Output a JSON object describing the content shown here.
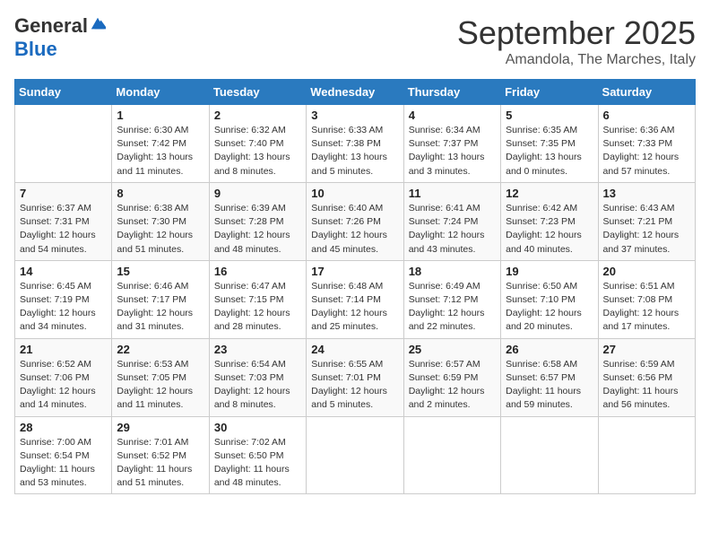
{
  "logo": {
    "general": "General",
    "blue": "Blue"
  },
  "title": "September 2025",
  "location": "Amandola, The Marches, Italy",
  "days_of_week": [
    "Sunday",
    "Monday",
    "Tuesday",
    "Wednesday",
    "Thursday",
    "Friday",
    "Saturday"
  ],
  "weeks": [
    [
      {
        "day": null
      },
      {
        "day": "1",
        "sunrise": "6:30 AM",
        "sunset": "7:42 PM",
        "daylight": "13 hours and 11 minutes."
      },
      {
        "day": "2",
        "sunrise": "6:32 AM",
        "sunset": "7:40 PM",
        "daylight": "13 hours and 8 minutes."
      },
      {
        "day": "3",
        "sunrise": "6:33 AM",
        "sunset": "7:38 PM",
        "daylight": "13 hours and 5 minutes."
      },
      {
        "day": "4",
        "sunrise": "6:34 AM",
        "sunset": "7:37 PM",
        "daylight": "13 hours and 3 minutes."
      },
      {
        "day": "5",
        "sunrise": "6:35 AM",
        "sunset": "7:35 PM",
        "daylight": "13 hours and 0 minutes."
      },
      {
        "day": "6",
        "sunrise": "6:36 AM",
        "sunset": "7:33 PM",
        "daylight": "12 hours and 57 minutes."
      }
    ],
    [
      {
        "day": "7",
        "sunrise": "6:37 AM",
        "sunset": "7:31 PM",
        "daylight": "12 hours and 54 minutes."
      },
      {
        "day": "8",
        "sunrise": "6:38 AM",
        "sunset": "7:30 PM",
        "daylight": "12 hours and 51 minutes."
      },
      {
        "day": "9",
        "sunrise": "6:39 AM",
        "sunset": "7:28 PM",
        "daylight": "12 hours and 48 minutes."
      },
      {
        "day": "10",
        "sunrise": "6:40 AM",
        "sunset": "7:26 PM",
        "daylight": "12 hours and 45 minutes."
      },
      {
        "day": "11",
        "sunrise": "6:41 AM",
        "sunset": "7:24 PM",
        "daylight": "12 hours and 43 minutes."
      },
      {
        "day": "12",
        "sunrise": "6:42 AM",
        "sunset": "7:23 PM",
        "daylight": "12 hours and 40 minutes."
      },
      {
        "day": "13",
        "sunrise": "6:43 AM",
        "sunset": "7:21 PM",
        "daylight": "12 hours and 37 minutes."
      }
    ],
    [
      {
        "day": "14",
        "sunrise": "6:45 AM",
        "sunset": "7:19 PM",
        "daylight": "12 hours and 34 minutes."
      },
      {
        "day": "15",
        "sunrise": "6:46 AM",
        "sunset": "7:17 PM",
        "daylight": "12 hours and 31 minutes."
      },
      {
        "day": "16",
        "sunrise": "6:47 AM",
        "sunset": "7:15 PM",
        "daylight": "12 hours and 28 minutes."
      },
      {
        "day": "17",
        "sunrise": "6:48 AM",
        "sunset": "7:14 PM",
        "daylight": "12 hours and 25 minutes."
      },
      {
        "day": "18",
        "sunrise": "6:49 AM",
        "sunset": "7:12 PM",
        "daylight": "12 hours and 22 minutes."
      },
      {
        "day": "19",
        "sunrise": "6:50 AM",
        "sunset": "7:10 PM",
        "daylight": "12 hours and 20 minutes."
      },
      {
        "day": "20",
        "sunrise": "6:51 AM",
        "sunset": "7:08 PM",
        "daylight": "12 hours and 17 minutes."
      }
    ],
    [
      {
        "day": "21",
        "sunrise": "6:52 AM",
        "sunset": "7:06 PM",
        "daylight": "12 hours and 14 minutes."
      },
      {
        "day": "22",
        "sunrise": "6:53 AM",
        "sunset": "7:05 PM",
        "daylight": "12 hours and 11 minutes."
      },
      {
        "day": "23",
        "sunrise": "6:54 AM",
        "sunset": "7:03 PM",
        "daylight": "12 hours and 8 minutes."
      },
      {
        "day": "24",
        "sunrise": "6:55 AM",
        "sunset": "7:01 PM",
        "daylight": "12 hours and 5 minutes."
      },
      {
        "day": "25",
        "sunrise": "6:57 AM",
        "sunset": "6:59 PM",
        "daylight": "12 hours and 2 minutes."
      },
      {
        "day": "26",
        "sunrise": "6:58 AM",
        "sunset": "6:57 PM",
        "daylight": "11 hours and 59 minutes."
      },
      {
        "day": "27",
        "sunrise": "6:59 AM",
        "sunset": "6:56 PM",
        "daylight": "11 hours and 56 minutes."
      }
    ],
    [
      {
        "day": "28",
        "sunrise": "7:00 AM",
        "sunset": "6:54 PM",
        "daylight": "11 hours and 53 minutes."
      },
      {
        "day": "29",
        "sunrise": "7:01 AM",
        "sunset": "6:52 PM",
        "daylight": "11 hours and 51 minutes."
      },
      {
        "day": "30",
        "sunrise": "7:02 AM",
        "sunset": "6:50 PM",
        "daylight": "11 hours and 48 minutes."
      },
      {
        "day": null
      },
      {
        "day": null
      },
      {
        "day": null
      },
      {
        "day": null
      }
    ]
  ]
}
